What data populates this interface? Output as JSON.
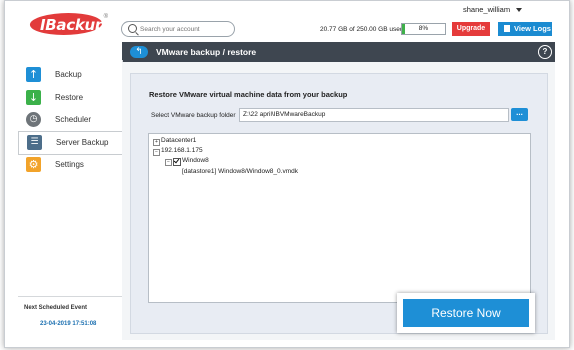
{
  "app": {
    "logo_text": "IBackup",
    "registered_mark": "®"
  },
  "header": {
    "search": {
      "placeholder": "Search your account"
    },
    "username": "shane_william",
    "usage_text": "20.77 GB of 250.00 GB used",
    "usage_percent_label": "8%",
    "usage_fraction": 0.08,
    "upgrade_label": "Upgrade",
    "view_logs_label": "View Logs"
  },
  "sidebar": {
    "items": [
      {
        "label": "Backup",
        "icon": "arrow-up-icon",
        "color": "#1e8fd6"
      },
      {
        "label": "Restore",
        "icon": "arrow-down-icon",
        "color": "#3bb14a"
      },
      {
        "label": "Scheduler",
        "icon": "clock-icon",
        "color": "#6e7479"
      },
      {
        "label": "Server Backup",
        "icon": "server-icon",
        "color": "#4d6e8a",
        "active": true
      },
      {
        "label": "Settings",
        "icon": "gear-icon",
        "color": "#f2a32a"
      }
    ],
    "next_event_label": "Next Scheduled Event",
    "next_event_date": "23-04-2019 17:51:08"
  },
  "main": {
    "title": "VMware backup / restore",
    "help_glyph": "?",
    "panel_title": "Restore VMware virtual machine data from your backup",
    "folder_label": "Select VMware backup folder",
    "folder_value": "Z:\\22 april\\IBVMwareBackup",
    "browse_label": "...",
    "tree": {
      "datacenter": "Datacenter1",
      "host": "192.168.1.175",
      "vm": "Window8",
      "disk": "[datastore1] Window8/Window8_0.vmdk"
    },
    "restore_button_label": "Restore Now"
  },
  "colors": {
    "brand_red": "#e23b3b",
    "accent_blue": "#1e8fd6",
    "header_dark": "#3e4650",
    "progress_green": "#3fb04a"
  }
}
